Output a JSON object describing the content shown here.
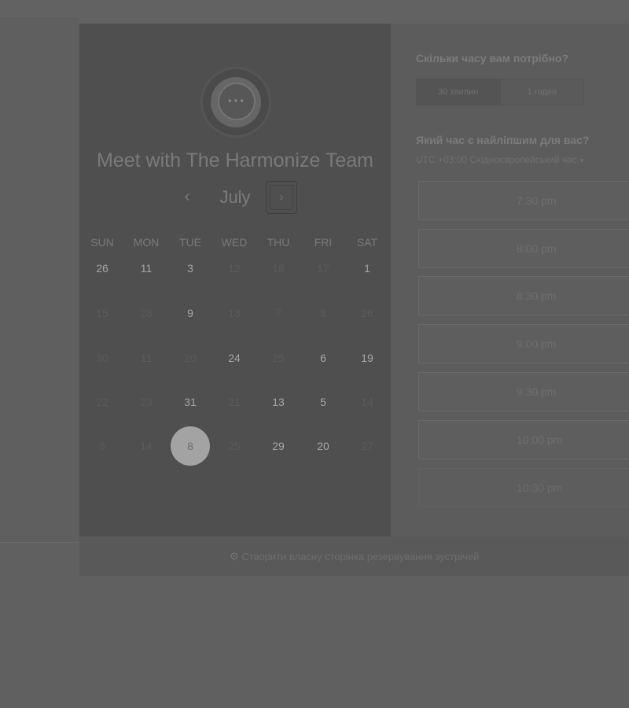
{
  "colors": {
    "overlay": "#606060",
    "calendar_panel": "#4f4f4f",
    "selected_day": "#a3a3a3"
  },
  "calendar": {
    "logo_icon": "chat-bubble-icon",
    "title": "Meet with The Harmonize Team",
    "month": "July",
    "prev_icon": "chevron-left-icon",
    "prev_symbol": "‹",
    "next_icon": "chevron-right-icon",
    "next_symbol": "›",
    "weekdays": [
      "SUN",
      "MON",
      "TUE",
      "WED",
      "THU",
      "FRI",
      "SAT"
    ],
    "weeks": [
      [
        {
          "d": "26",
          "a": true
        },
        {
          "d": "11",
          "a": true
        },
        {
          "d": "3",
          "a": true
        },
        {
          "d": "12",
          "a": false
        },
        {
          "d": "18",
          "a": false
        },
        {
          "d": "17",
          "a": false
        },
        {
          "d": "1",
          "a": true
        }
      ],
      [
        {
          "d": "15",
          "a": false
        },
        {
          "d": "28",
          "a": false
        },
        {
          "d": "9",
          "a": true
        },
        {
          "d": "13",
          "a": false
        },
        {
          "d": "7",
          "a": false
        },
        {
          "d": "8",
          "a": false
        },
        {
          "d": "26",
          "a": false
        }
      ],
      [
        {
          "d": "30",
          "a": false
        },
        {
          "d": "11",
          "a": false
        },
        {
          "d": "20",
          "a": false
        },
        {
          "d": "24",
          "a": true
        },
        {
          "d": "25",
          "a": false
        },
        {
          "d": "6",
          "a": true
        },
        {
          "d": "19",
          "a": true
        }
      ],
      [
        {
          "d": "22",
          "a": false
        },
        {
          "d": "23",
          "a": false
        },
        {
          "d": "31",
          "a": true
        },
        {
          "d": "21",
          "a": false
        },
        {
          "d": "13",
          "a": true
        },
        {
          "d": "5",
          "a": true
        },
        {
          "d": "14",
          "a": false
        }
      ],
      [
        {
          "d": "5",
          "a": false
        },
        {
          "d": "14",
          "a": false
        },
        {
          "d": "8",
          "a": true,
          "selected": true
        },
        {
          "d": "25",
          "a": false
        },
        {
          "d": "29",
          "a": true
        },
        {
          "d": "20",
          "a": true
        },
        {
          "d": "27",
          "a": false
        }
      ]
    ]
  },
  "booking": {
    "duration_heading": "Скільки часу вам потрібно?",
    "durations": [
      "30 хвилин",
      "1 годин"
    ],
    "time_heading": "Який час є найліпшим для вас?",
    "timezone": "UTC +03:00 Східноєвропейський час",
    "timezone_caret": "▾",
    "slots": [
      "7:30 pm",
      "8:00 pm",
      "8:30 pm",
      "9:00 pm",
      "9:30 pm",
      "10:00 pm",
      "10:30 pm"
    ]
  },
  "footer": {
    "icon": "sprocket-icon",
    "symbol": "⚙",
    "text": "Створити власну сторінка резервування зустрічей"
  }
}
